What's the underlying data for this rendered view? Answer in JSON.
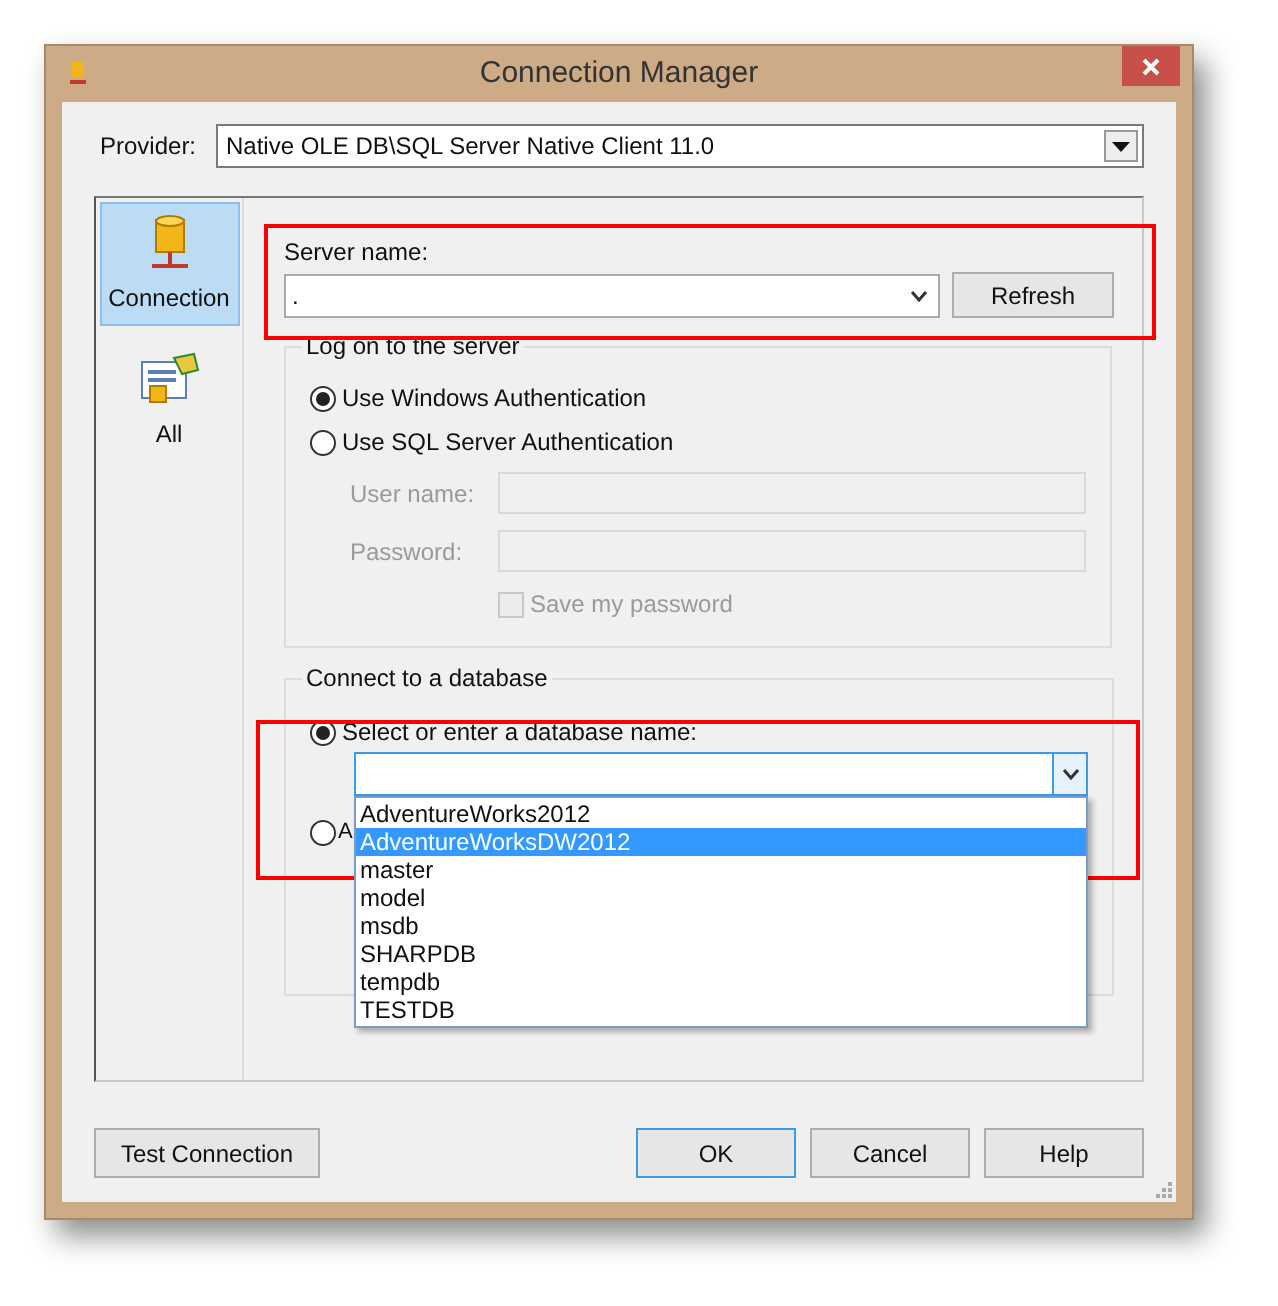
{
  "window": {
    "title": "Connection Manager"
  },
  "provider": {
    "label": "Provider:",
    "value": "Native OLE DB\\SQL Server Native Client 11.0"
  },
  "nav": [
    {
      "label": "Connection",
      "kind": "connection",
      "selected": true
    },
    {
      "label": "All",
      "kind": "all",
      "selected": false
    }
  ],
  "server": {
    "label": "Server name:",
    "value": ".",
    "refresh": "Refresh"
  },
  "logon": {
    "legend": "Log on to the server",
    "options": [
      {
        "label": "Use Windows Authentication",
        "selected": true
      },
      {
        "label": "Use SQL Server Authentication",
        "selected": false
      }
    ],
    "fields": [
      {
        "label": "User name:",
        "disabled": true
      },
      {
        "label": "Password:",
        "disabled": true
      }
    ],
    "save_password": {
      "label": "Save my password",
      "checked": false,
      "disabled": true
    }
  },
  "database": {
    "legend": "Connect to a database",
    "options": [
      {
        "label": "Select or enter a database name:",
        "selected": true
      },
      {
        "label": "A",
        "selected": false
      }
    ],
    "list": [
      {
        "label": "AdventureWorks2012",
        "selected": false
      },
      {
        "label": "AdventureWorksDW2012",
        "selected": true
      },
      {
        "label": "master",
        "selected": false
      },
      {
        "label": "model",
        "selected": false
      },
      {
        "label": "msdb",
        "selected": false
      },
      {
        "label": "SHARPDB",
        "selected": false
      },
      {
        "label": "tempdb",
        "selected": false
      },
      {
        "label": "TESTDB",
        "selected": false
      }
    ]
  },
  "buttons": [
    {
      "label": "Test Connection",
      "kind": "test"
    },
    {
      "label": "OK",
      "kind": "default"
    },
    {
      "label": "Cancel",
      "kind": "normal"
    },
    {
      "label": "Help",
      "kind": "normal"
    }
  ]
}
